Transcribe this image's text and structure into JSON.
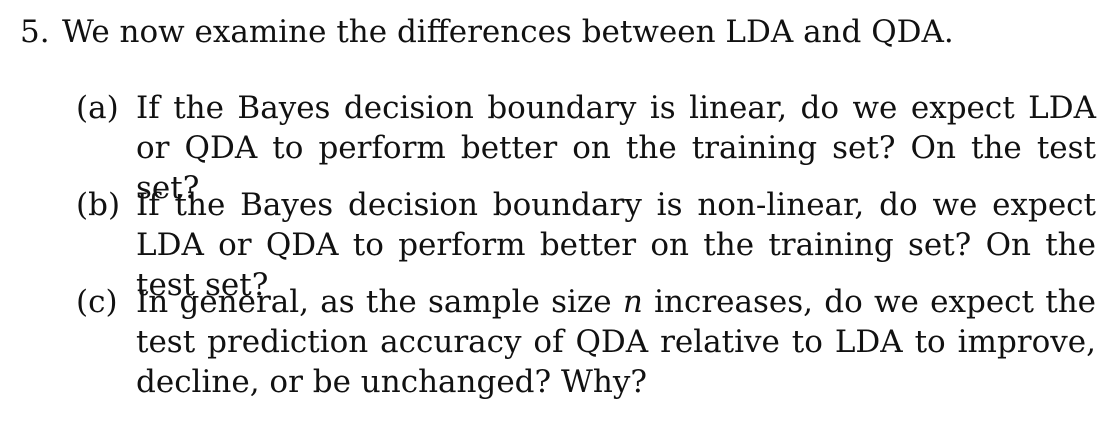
{
  "problem": {
    "number": "5.",
    "title": "We now examine the differences between LDA and QDA."
  },
  "parts": [
    {
      "label": "(a)",
      "text": "If the Bayes decision boundary is linear, do we expect LDA or QDA to perform better on the training set? On the test set?"
    },
    {
      "label": "(b)",
      "text": "If the Bayes decision boundary is non-linear, do we expect LDA or QDA to perform better on the training set? On the test set?"
    },
    {
      "label": "(c)",
      "text_before": "In general, as the sample size",
      "variable": "n",
      "text_after": "increases, do we expect the test prediction accuracy of QDA relative to LDA to improve, decline, or be unchanged? Why?"
    }
  ]
}
